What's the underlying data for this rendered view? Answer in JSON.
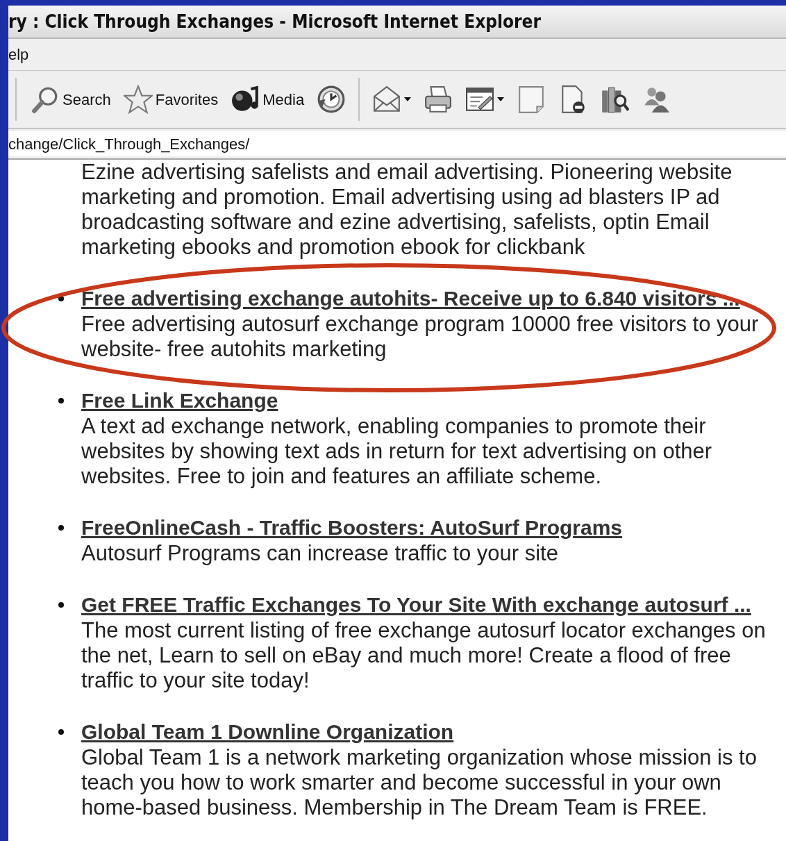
{
  "window": {
    "title": "ry : Click Through Exchanges - Microsoft Internet Explorer"
  },
  "menu_bar": {
    "items": [
      "elp"
    ]
  },
  "toolbar": {
    "buttons": [
      {
        "kind": "search",
        "label": "Search",
        "dropdown": false
      },
      {
        "kind": "favorites",
        "label": "Favorites",
        "dropdown": false
      },
      {
        "kind": "media",
        "label": "Media",
        "dropdown": false
      },
      {
        "kind": "history",
        "dropdown": false
      },
      {
        "kind": "mail",
        "dropdown": true
      },
      {
        "kind": "print",
        "dropdown": false
      },
      {
        "kind": "edit",
        "dropdown": true
      },
      {
        "kind": "page",
        "dropdown": false
      },
      {
        "kind": "page-minus",
        "dropdown": false
      },
      {
        "kind": "research",
        "dropdown": false
      },
      {
        "kind": "messenger",
        "dropdown": false
      }
    ]
  },
  "address_bar": {
    "value": "change/Click_Through_Exchanges/"
  },
  "page": {
    "intro": "Ezine advertising safelists and email advertising. Pioneering website marketing and promotion. Email advertising using ad blasters IP ad broadcasting software and ezine advertising, safelists, optin Email marketing ebooks and promotion ebook for clickbank",
    "results": [
      {
        "title": "Free advertising exchange autohits- Receive up to 6.840 visitors ...",
        "description": "Free advertising autosurf exchange program 10000 free visitors to your website- free autohits marketing",
        "highlighted": true
      },
      {
        "title": "Free Link Exchange",
        "description": "A text ad exchange network, enabling companies to promote their websites by showing text ads in return for text advertising on other websites. Free to join and features an affiliate scheme.",
        "highlighted": false
      },
      {
        "title": "FreeOnlineCash - Traffic Boosters: AutoSurf Programs",
        "description": "Autosurf Programs can increase traffic to your site",
        "highlighted": false
      },
      {
        "title": "Get FREE Traffic Exchanges To Your Site With exchange autosurf ...",
        "description": "The most current listing of free exchange autosurf locator exchanges on the net, Learn to sell on eBay and much more! Create a flood of free traffic to your site today!",
        "highlighted": false
      },
      {
        "title": "Global Team 1 Downline Organization",
        "description": "Global Team 1 is a network marketing organization whose mission is to teach you how to work smarter and become successful in your own home-based business. Membership in The Dream Team is FREE.",
        "highlighted": false
      }
    ]
  }
}
